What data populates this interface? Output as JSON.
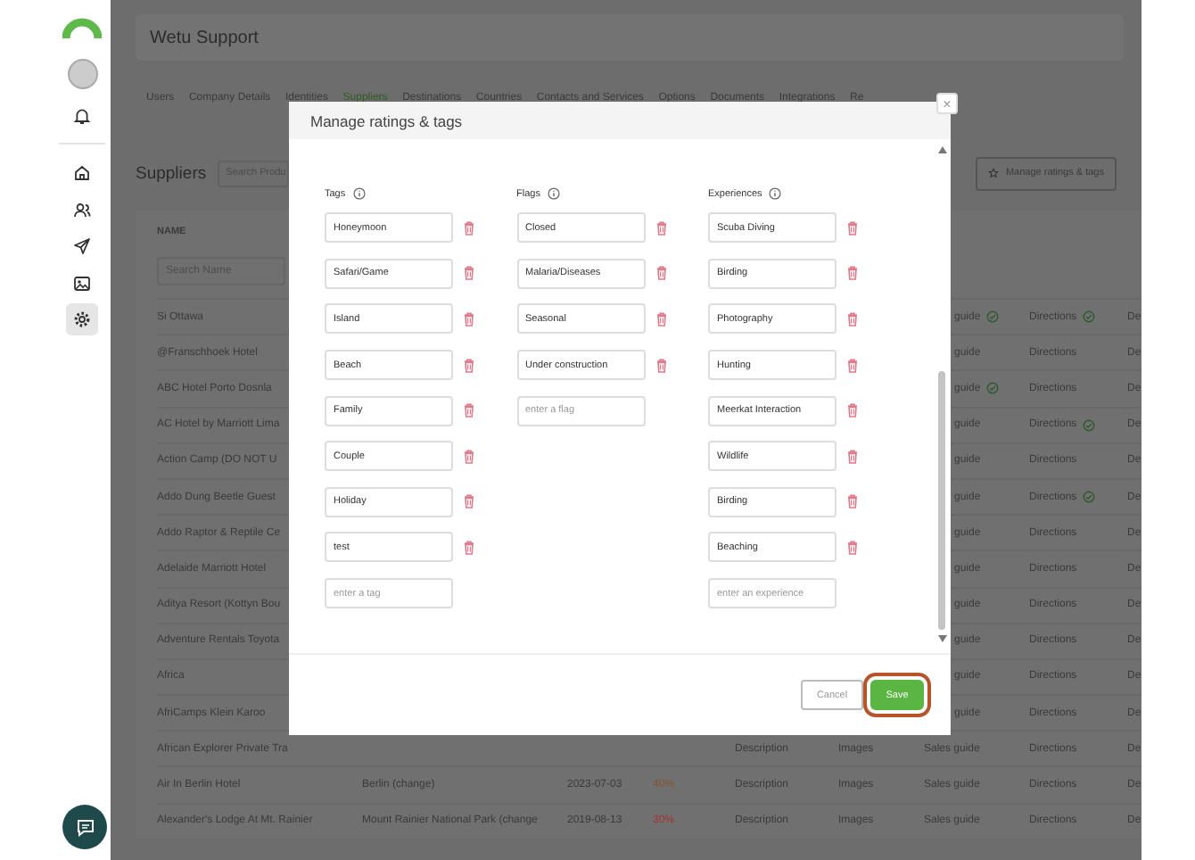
{
  "sidebar": {
    "items": [
      {
        "selected": false
      },
      {
        "selected": false
      },
      {
        "selected": false
      },
      {
        "selected": false
      },
      {
        "selected": true
      }
    ]
  },
  "header": {
    "title": "Wetu Support"
  },
  "tabs": [
    {
      "label": "Users",
      "selected": false
    },
    {
      "label": "Company Details",
      "selected": false
    },
    {
      "label": "Identities",
      "selected": false
    },
    {
      "label": "Suppliers",
      "selected": true
    },
    {
      "label": "Destinations",
      "selected": false
    },
    {
      "label": "Countries",
      "selected": false
    },
    {
      "label": "Contacts and Services",
      "selected": false
    },
    {
      "label": "Options",
      "selected": false
    },
    {
      "label": "Documents",
      "selected": false
    },
    {
      "label": "Integrations",
      "selected": false
    },
    {
      "label": "Re",
      "selected": false
    }
  ],
  "suppliers": {
    "title": "Suppliers",
    "search_placeholder": "Search Produ",
    "manage_button": "Manage ratings & tags"
  },
  "table": {
    "columns": [
      "NAME"
    ],
    "name_search_placeholder": "Search Name",
    "rows": [
      {
        "kind": "covered",
        "name": "Si Ottawa",
        "sales_guide": "guide",
        "sales_guide_verified": true,
        "directions": "Directions",
        "directions_verified": true,
        "column_9": "De"
      },
      {
        "kind": "covered",
        "name": "@Franschhoek Hotel",
        "sales_guide": "guide",
        "sales_guide_verified": false,
        "directions": "Directions",
        "directions_verified": false,
        "column_9": "De"
      },
      {
        "kind": "covered",
        "name": "ABC Hotel Porto Dosnla",
        "sales_guide": "guide",
        "sales_guide_verified": true,
        "directions": "Directions",
        "directions_verified": false,
        "column_9": "De"
      },
      {
        "kind": "covered",
        "name": "AC Hotel by Marriott Lima",
        "sales_guide": "guide",
        "sales_guide_verified": false,
        "directions": "Directions",
        "directions_verified": true,
        "column_9": "De"
      },
      {
        "kind": "covered",
        "name": "Action Camp (DO NOT U",
        "sales_guide": "guide",
        "sales_guide_verified": false,
        "directions": "Directions",
        "directions_verified": false,
        "column_9": "De"
      },
      {
        "kind": "covered",
        "name": "Addo Dung Beetle Guest",
        "sales_guide": "guide",
        "sales_guide_verified": false,
        "directions": "Directions",
        "directions_verified": true,
        "column_9": "De"
      },
      {
        "kind": "covered",
        "name": "Addo Raptor & Reptile Ce",
        "sales_guide": "guide",
        "sales_guide_verified": false,
        "directions": "Directions",
        "directions_verified": false,
        "column_9": "De"
      },
      {
        "kind": "covered",
        "name": "Adelaide Marriott Hotel",
        "sales_guide": "guide",
        "sales_guide_verified": false,
        "directions": "Directions",
        "directions_verified": false,
        "column_9": "De"
      },
      {
        "kind": "covered",
        "name": "Aditya Resort (Kottyn Bou",
        "sales_guide": "guide",
        "sales_guide_verified": false,
        "directions": "Directions",
        "directions_verified": false,
        "column_9": "De"
      },
      {
        "kind": "covered",
        "name": "Adventure Rentals Toyota",
        "sales_guide": "guide",
        "sales_guide_verified": false,
        "directions": "Directions",
        "directions_verified": false,
        "column_9": "De"
      },
      {
        "kind": "covered",
        "name": "Africa",
        "sales_guide": "guide",
        "sales_guide_verified": false,
        "directions": "Directions",
        "directions_verified": false,
        "column_9": "De"
      },
      {
        "kind": "covered",
        "name": "AfriCamps Klein Karoo",
        "sales_guide": "guide",
        "sales_guide_verified": false,
        "directions": "Directions",
        "directions_verified": false,
        "column_9": "De"
      },
      {
        "kind": "full",
        "name": "African Explorer Private Tra",
        "description": "Description",
        "images": "Images",
        "sales_guide": "Sales guide",
        "sales_guide_verified": false,
        "directions": "Directions",
        "directions_verified": false,
        "column_9": "De"
      },
      {
        "kind": "full",
        "name": "Air In Berlin Hotel",
        "location": "Berlin (change)",
        "date": "2023-07-03",
        "percent": {
          "text": "40%",
          "color": "#8a5230"
        },
        "description": "Description",
        "images": "Images",
        "sales_guide": "Sales guide",
        "sales_guide_verified": false,
        "directions": "Directions",
        "directions_verified": false,
        "column_9": "De"
      },
      {
        "kind": "full",
        "name": "Alexander's Lodge At Mt. Rainier",
        "location": "Mount Rainier National Park (change",
        "date": "2019-08-13",
        "percent": {
          "text": "30%",
          "color": "#a83232"
        },
        "description": "Description",
        "images": "Images",
        "sales_guide": "Sales guide",
        "sales_guide_verified": false,
        "directions": "Directions",
        "directions_verified": false,
        "column_9": "De"
      }
    ]
  },
  "modal": {
    "title": "Manage ratings & tags",
    "close": "×",
    "columns": [
      {
        "label": "Tags",
        "items": [
          "Honeymoon",
          "Safari/Game",
          "Island",
          "Beach",
          "Family",
          "Couple",
          "Holiday",
          "test"
        ],
        "placeholder": "enter a tag"
      },
      {
        "label": "Flags",
        "items": [
          "Closed",
          "Malaria/Diseases",
          "Seasonal",
          "Under construction"
        ],
        "placeholder": "enter a flag"
      },
      {
        "label": "Experiences",
        "items": [
          "Scuba Diving",
          "Birding",
          "Photography",
          "Hunting",
          "Meerkat Interaction",
          "Wildlife",
          "Birding",
          "Beaching"
        ],
        "placeholder": "enter an experience"
      }
    ],
    "cancel": "Cancel",
    "save": {
      "label": "Save",
      "highlighted": true
    }
  }
}
